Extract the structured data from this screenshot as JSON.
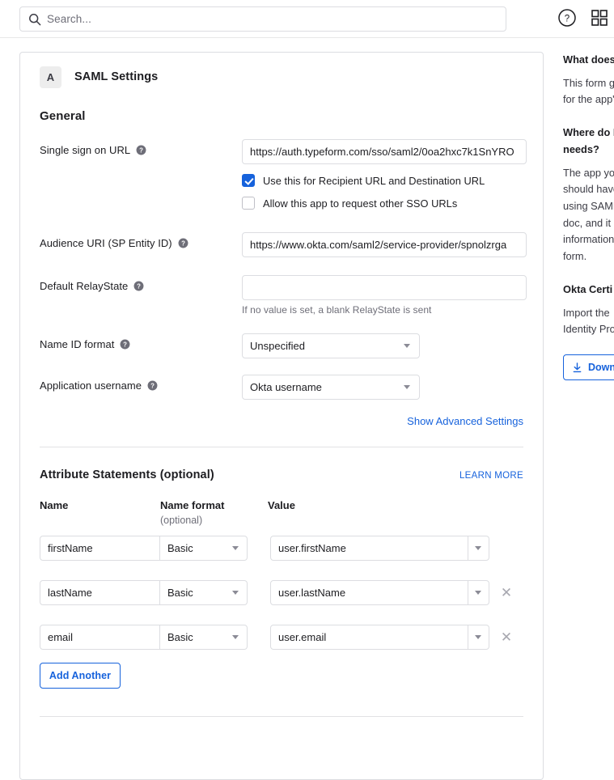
{
  "topbar": {
    "search_placeholder": "Search...",
    "help_icon": "help-circle-icon",
    "apps_icon": "apps-grid-icon"
  },
  "card": {
    "badge_letter": "A",
    "title": "SAML Settings",
    "general_section": "General",
    "fields": {
      "sso_url": {
        "label": "Single sign on URL",
        "value": "https://auth.typeform.com/sso/saml2/0oa2hxc7k1SnYRO",
        "checkbox_recipient": "Use this for Recipient URL and Destination URL",
        "checkbox_recipient_checked": true,
        "checkbox_other_sso": "Allow this app to request other SSO URLs",
        "checkbox_other_sso_checked": false
      },
      "audience_uri": {
        "label": "Audience URI (SP Entity ID)",
        "value": "https://www.okta.com/saml2/service-provider/spnolzrga"
      },
      "relay_state": {
        "label": "Default RelayState",
        "value": "",
        "hint": "If no value is set, a blank RelayState is sent"
      },
      "name_id_format": {
        "label": "Name ID format",
        "value": "Unspecified"
      },
      "app_username": {
        "label": "Application username",
        "value": "Okta username"
      }
    },
    "show_advanced_link": "Show Advanced Settings",
    "attributes": {
      "title": "Attribute Statements (optional)",
      "learn_more": "LEARN MORE",
      "columns": {
        "name": "Name",
        "name_format": "Name format",
        "name_format_sub": "(optional)",
        "value": "Value"
      },
      "rows": [
        {
          "name": "firstName",
          "format": "Basic",
          "value": "user.firstName",
          "removable": false
        },
        {
          "name": "lastName",
          "format": "Basic",
          "value": "user.lastName",
          "removable": true
        },
        {
          "name": "email",
          "format": "Basic",
          "value": "user.email",
          "removable": true
        }
      ],
      "add_another": "Add Another"
    }
  },
  "help_panel": {
    "q1_title": "What does",
    "q1_body": "This form g\nfor the app'",
    "q2_title": "Where do I\nneeds?",
    "q2_body": "The app you\nshould have\nusing SAML\ndoc, and it \ninformation\nform.",
    "q3_title": "Okta Certi",
    "q3_body": "Import the \nIdentity Pro",
    "download_label": "Down"
  },
  "colors": {
    "accent": "#1662dc",
    "border": "#dcdde1",
    "text": "#1d1d21",
    "muted": "#6e6e78"
  }
}
